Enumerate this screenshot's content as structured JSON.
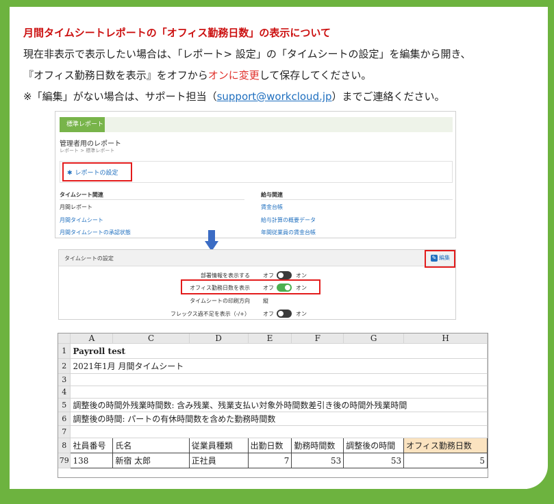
{
  "heading": "月間タイムシートレポートの「オフィス勤務日数」の表示について",
  "body": {
    "line1": "現在非表示で表示したい場合は、「レポート> 設定」の「タイムシートの設定」を編集から開き、",
    "line2_prefix": "『オフィス勤務日数を表示』をオフから",
    "line2_red": "オンに変更",
    "line2_suffix": "して保存してください。",
    "line3_prefix": "※「編集」がない場合は、サポート担当（",
    "line3_email": "support@workcloud.jp",
    "line3_suffix": "）までご連絡ください。"
  },
  "reports": {
    "tab": "標準レポート",
    "title": "管理者用のレポート",
    "breadcrumb": "レポート > 標準レポート",
    "settings_link": "レポートの設定",
    "timesheet_head": "タイムシート関連",
    "timesheet_items": [
      "月間レポート",
      "月間タイムシート",
      "月間タイムシートの承認状態"
    ],
    "payroll_head": "給与関連",
    "payroll_items": [
      "賃金台帳",
      "給与計算の概要データ",
      "年間従業員の賃金台帳"
    ]
  },
  "timesheet_settings": {
    "title": "タイムシートの設定",
    "edit": "編集",
    "rows": [
      {
        "label": "部署情報を表示する",
        "off": "オフ",
        "on": "オン",
        "state": "off"
      },
      {
        "label": "オフィス勤務日数を表示",
        "off": "オフ",
        "on": "オン",
        "state": "on"
      },
      {
        "label": "タイムシートの印刷方向",
        "value": "縦"
      },
      {
        "label": "フレックス過不足を表示（-/+）",
        "off": "オフ",
        "on": "オン",
        "state": "off"
      }
    ]
  },
  "sheet": {
    "columns": [
      "A",
      "C",
      "D",
      "E",
      "F",
      "G",
      "H"
    ],
    "rows": {
      "r1": "Payroll test",
      "r2": "2021年1月 月間タイムシート",
      "r5": "調整後の時間外残業時間数: 含み残業、残業支払い対象外時間数差引き後の時間外残業時間",
      "r6": "調整後の時間: パートの有休時間数を含めた勤務時間数"
    },
    "row_numbers": [
      "1",
      "2",
      "3",
      "4",
      "5",
      "6",
      "7",
      "8",
      "79"
    ],
    "header_cells": [
      "社員番号",
      "氏名",
      "従業員種類",
      "出勤日数",
      "勤務時間数",
      "調整後の時間",
      "オフィス勤務日数"
    ],
    "data_cells": [
      "138",
      "新宿 太郎",
      "正社員",
      "7",
      "53",
      "53",
      "5"
    ]
  }
}
